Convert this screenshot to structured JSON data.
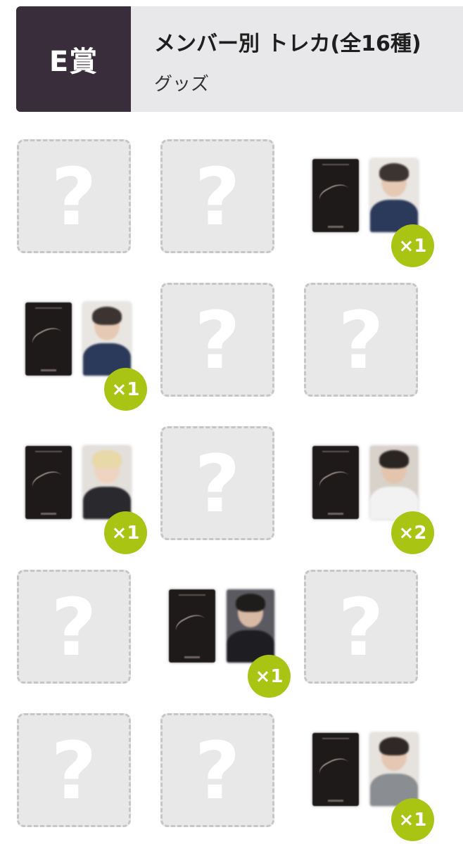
{
  "header": {
    "prize_label": "E賞",
    "title": "メンバー別 トレカ(全16種)",
    "category": "グッズ"
  },
  "unknown_glyph": "?",
  "colors": {
    "badge_bg": "#3a2d3b",
    "header_bg": "#e8e8ea",
    "count_badge": "#a9c413",
    "placeholder_bg": "#e8e8e8"
  },
  "grid": [
    {
      "state": "unknown"
    },
    {
      "state": "unknown"
    },
    {
      "state": "owned",
      "count": "×1",
      "photo": {
        "bg": "#e9e6e2",
        "hair": "#3b3431",
        "skin": "#e6c9b4",
        "body": "#2b3a5a"
      }
    },
    {
      "state": "owned",
      "count": "×1",
      "photo": {
        "bg": "#e9e6e2",
        "hair": "#3b3431",
        "skin": "#e6c9b4",
        "body": "#2b3a5a"
      }
    },
    {
      "state": "unknown"
    },
    {
      "state": "unknown"
    },
    {
      "state": "owned",
      "count": "×1",
      "photo": {
        "bg": "#e3dfda",
        "hair": "#e8d9a8",
        "skin": "#efd4c2",
        "body": "#2a2a2e"
      }
    },
    {
      "state": "unknown"
    },
    {
      "state": "owned",
      "count": "×2",
      "photo": {
        "bg": "#d9d2ca",
        "hair": "#2a2523",
        "skin": "#e3c5ad",
        "body": "#f2f2f2"
      }
    },
    {
      "state": "unknown"
    },
    {
      "state": "owned",
      "count": "×1",
      "photo": {
        "bg": "#5a5a60",
        "hair": "#1f1c1c",
        "skin": "#d8b9a4",
        "body": "#1e1e22"
      }
    },
    {
      "state": "unknown"
    },
    {
      "state": "unknown"
    },
    {
      "state": "unknown"
    },
    {
      "state": "owned",
      "count": "×1",
      "photo": {
        "bg": "#e6e2dd",
        "hair": "#2e2826",
        "skin": "#e5c8b3",
        "body": "#8a8d92"
      }
    }
  ]
}
